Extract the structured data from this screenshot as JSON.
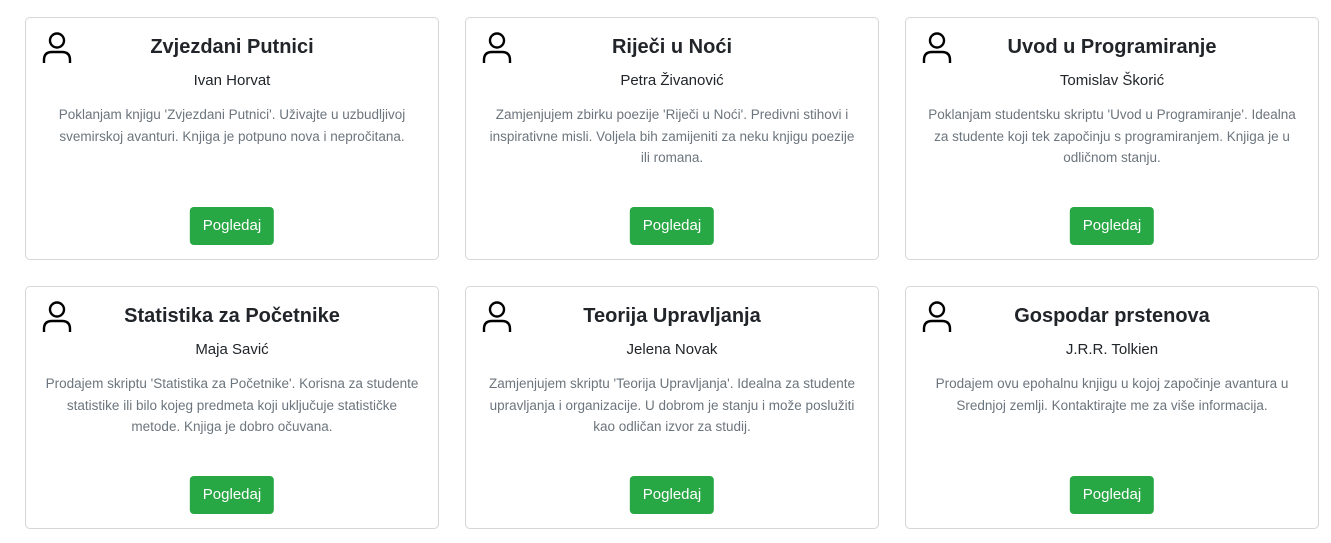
{
  "cards": [
    {
      "title": "Zvjezdani Putnici",
      "author": "Ivan Horvat",
      "description": "Poklanjam knjigu 'Zvjezdani Putnici'. Uživajte u uzbudljivoj svemirskoj avanturi. Knjiga je potpuno nova i nepročitana.",
      "button_label": "Pogledaj",
      "icon": "person-icon"
    },
    {
      "title": "Riječi u Noći",
      "author": "Petra Živanović",
      "description": "Zamjenjujem zbirku poezije 'Riječi u Noći'. Predivni stihovi i inspirativne misli. Voljela bih zamijeniti za neku knjigu poezije ili romana.",
      "button_label": "Pogledaj",
      "icon": "person-icon"
    },
    {
      "title": "Uvod u Programiranje",
      "author": "Tomislav Škorić",
      "description": "Poklanjam studentsku skriptu 'Uvod u Programiranje'. Idealna za studente koji tek započinju s programiranjem. Knjiga je u odličnom stanju.",
      "button_label": "Pogledaj",
      "icon": "person-icon"
    },
    {
      "title": "Statistika za Početnike",
      "author": "Maja Savić",
      "description": "Prodajem skriptu 'Statistika za Početnike'. Korisna za studente statistike ili bilo kojeg predmeta koji uključuje statističke metode. Knjiga je dobro očuvana.",
      "button_label": "Pogledaj",
      "icon": "person-icon"
    },
    {
      "title": "Teorija Upravljanja",
      "author": "Jelena Novak",
      "description": "Zamjenjujem skriptu 'Teorija Upravljanja'. Idealna za studente upravljanja i organizacije. U dobrom je stanju i može poslužiti kao odličan izvor za studij.",
      "button_label": "Pogledaj",
      "icon": "person-icon"
    },
    {
      "title": "Gospodar prstenova",
      "author": "J.R.R. Tolkien",
      "description": "Prodajem ovu epohalnu knjigu u kojoj započinje avantura u Srednjoj zemlji. Kontaktirajte me za više informacija.",
      "button_label": "Pogledaj",
      "icon": "person-icon"
    }
  ],
  "colors": {
    "button_bg": "#28a745",
    "button_text": "#ffffff",
    "title_text": "#212529",
    "description_text": "#6c757d",
    "card_border": "#d6d6d6"
  }
}
